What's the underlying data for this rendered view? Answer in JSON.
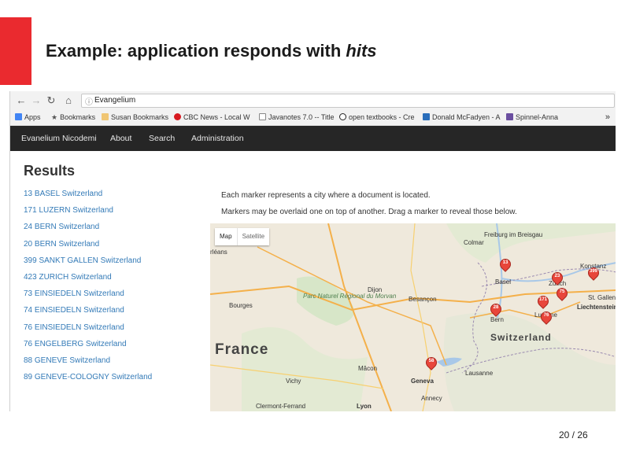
{
  "slide": {
    "title_prefix": "Example: application responds with ",
    "title_emphasis": "hits",
    "accent_color": "#ea2a2f",
    "page_number": "20 / 26"
  },
  "browser": {
    "address_value": "Evangelium",
    "bookmarks": [
      {
        "label": "Apps",
        "icon": "apps-grid-icon",
        "color": "#4285f4"
      },
      {
        "label": "Bookmarks",
        "icon": "star-icon",
        "color": "#555555"
      },
      {
        "label": "Susan Bookmarks",
        "icon": "folder-icon",
        "color": "#f0c674"
      },
      {
        "label": "CBC News - Local W",
        "icon": "cbc-logo-icon",
        "color": "#d71920"
      },
      {
        "label": "Javanotes 7.0 -- Title",
        "icon": "page-icon",
        "color": "#888888"
      },
      {
        "label": "open textbooks - Cre",
        "icon": "cc-icon",
        "color": "#222222"
      },
      {
        "label": "Donald McFadyen - A",
        "icon": "page-icon",
        "color": "#2a6ebb"
      },
      {
        "label": "Spinnel-Anna",
        "icon": "page-icon",
        "color": "#6b4fa0"
      }
    ],
    "more_label": "»"
  },
  "app_nav": {
    "brand": "Evanelium Nicodemi",
    "links": [
      "About",
      "Search",
      "Administration"
    ]
  },
  "results": {
    "heading": "Results",
    "items": [
      "13 BASEL Switzerland",
      "171 LUZERN Switzerland",
      "24 BERN Switzerland",
      "20 BERN Switzerland",
      "399 SANKT GALLEN Switzerland",
      "423 ZURICH Switzerland",
      "73 EINSIEDELN Switzerland",
      "74 EINSIEDELN Switzerland",
      "76 EINSIEDELN Switzerland",
      "76 ENGELBERG Switzerland",
      "88 GENEVE Switzerland",
      "89 GENEVE-COLOGNY Switzerland"
    ],
    "note_1": "Each marker represents a city where a document is located.",
    "note_2": "Markers may be overlaid one on top of another. Drag a marker to reveal those below."
  },
  "map": {
    "type_options": [
      "Map",
      "Satellite"
    ],
    "selected_type": "Map",
    "labels": {
      "france": "France",
      "switzerland": "Switzerland",
      "freiburg": "Freiburg im Breisgau",
      "colmar": "Colmar",
      "basel": "Basel",
      "zurich": "Zurich",
      "konstanz": "Konstanz",
      "st_gallen": "St. Gallen",
      "liechtenstein": "Liechtenstein",
      "dijon": "Dijon",
      "besancon": "Besançon",
      "bern": "Bern",
      "lucerne": "Lucerne",
      "bourges": "Bourges",
      "macon": "Mâcon",
      "vichy": "Vichy",
      "geneva": "Geneva",
      "lausanne": "Lausanne",
      "annecy": "Annecy",
      "lyon": "Lyon",
      "clermont": "Clermont-Ferrand",
      "orleans": "rléans",
      "morvan": "Parc Naturel Régional du Morvan"
    },
    "markers": [
      "13",
      "23",
      "399",
      "75",
      "171",
      "28",
      "76",
      "58"
    ]
  }
}
